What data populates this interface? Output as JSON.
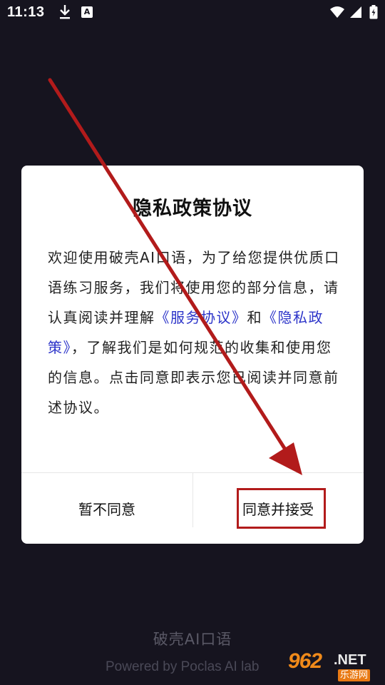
{
  "status_bar": {
    "time": "11:13",
    "notification_icons": [
      "download-icon",
      "a-icon"
    ],
    "a_icon_letter": "A",
    "system_icons": [
      "wifi-icon",
      "signal-icon",
      "battery-icon"
    ]
  },
  "dialog": {
    "title": "隐私政策协议",
    "body_parts": {
      "p1": "欢迎使用破壳AI口语，为了给您提供优质口语练习服务，我们将使用您的部分信息，请认真阅读并理解",
      "link_service": "《服务协议》",
      "and": "和",
      "link_privacy": "《隐私政策》",
      "p2": "，了解我们是如何规范的收集和使用您的信息。点击同意即表示您已阅读并同意前述协议。"
    },
    "decline_label": "暂不同意",
    "accept_label": "同意并接受"
  },
  "branding": {
    "app_name": "破壳AI口语",
    "powered_by": "Powered by Poclas AI lab"
  },
  "watermark": {
    "number": "962",
    "domain": ".NET",
    "subtitle": "乐游网"
  },
  "colors": {
    "background": "#16141f",
    "link": "#2c34c9",
    "annotation_red": "#b21b1b",
    "watermark_orange": "#f08a1a"
  }
}
